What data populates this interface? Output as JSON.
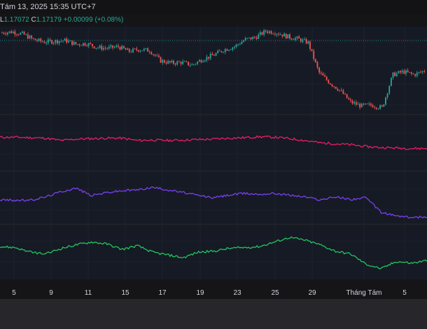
{
  "header": {
    "date_text": "Tám 13, 2025 15:35 UTC+7"
  },
  "legend": {
    "l_label": "L",
    "l_value": "1.17072",
    "c_label": "C",
    "c_value": "1.17179",
    "change": "+0.00099 (+0.08%)"
  },
  "colors": {
    "background": "#151518",
    "up_candle": "#26a69a",
    "down_candle": "#ef5350",
    "series_magenta": "#e91e63",
    "series_purple": "#7b3ff2",
    "series_green": "#22c55e",
    "last_price_line": "#26a69a",
    "axis_text": "#d1d4dc"
  },
  "chart_data": {
    "type": "line",
    "x_axis_ticks": [
      "5",
      "9",
      "11",
      "15",
      "17",
      "19",
      "23",
      "25",
      "29",
      "Tháng Tám",
      "5"
    ],
    "candles_close_approx": [
      1.1748,
      1.175,
      1.1744,
      1.173,
      1.1724,
      1.1726,
      1.1728,
      1.1718,
      1.172,
      1.171,
      1.1708,
      1.1712,
      1.17,
      1.1705,
      1.1702,
      1.1676,
      1.167,
      1.1672,
      1.1665,
      1.168,
      1.169,
      1.1704,
      1.1712,
      1.173,
      1.1736,
      1.1752,
      1.1748,
      1.1738,
      1.1732,
      1.1722,
      1.1646,
      1.162,
      1.16,
      1.157,
      1.156,
      1.1562,
      1.1555,
      1.164,
      1.1648,
      1.164,
      1.165
    ],
    "series": [
      {
        "name": "",
        "color": "#e91e63",
        "values": [
          0.62,
          0.62,
          0.61,
          0.6,
          0.55,
          0.58,
          0.59,
          0.6,
          0.6,
          0.55,
          0.56,
          0.55,
          0.56,
          0.57,
          0.58,
          0.6,
          0.61,
          0.63,
          0.62,
          0.59,
          0.55,
          0.5,
          0.48,
          0.46,
          0.42,
          0.4,
          0.39,
          0.38,
          0.38
        ]
      },
      {
        "name": "",
        "color": "#7b3ff2",
        "values": [
          0.45,
          0.44,
          0.44,
          0.52,
          0.64,
          0.72,
          0.55,
          0.62,
          0.66,
          0.68,
          0.74,
          0.68,
          0.62,
          0.55,
          0.5,
          0.56,
          0.6,
          0.58,
          0.6,
          0.56,
          0.52,
          0.45,
          0.52,
          0.46,
          0.5,
          0.16,
          0.08,
          0.04,
          0.06
        ]
      },
      {
        "name": "",
        "color": "#22c55e",
        "values": [
          0.62,
          0.6,
          0.5,
          0.46,
          0.58,
          0.66,
          0.72,
          0.68,
          0.56,
          0.64,
          0.5,
          0.44,
          0.38,
          0.5,
          0.52,
          0.58,
          0.6,
          0.62,
          0.72,
          0.82,
          0.76,
          0.66,
          0.52,
          0.46,
          0.24,
          0.14,
          0.3,
          0.26,
          0.32
        ]
      }
    ]
  }
}
